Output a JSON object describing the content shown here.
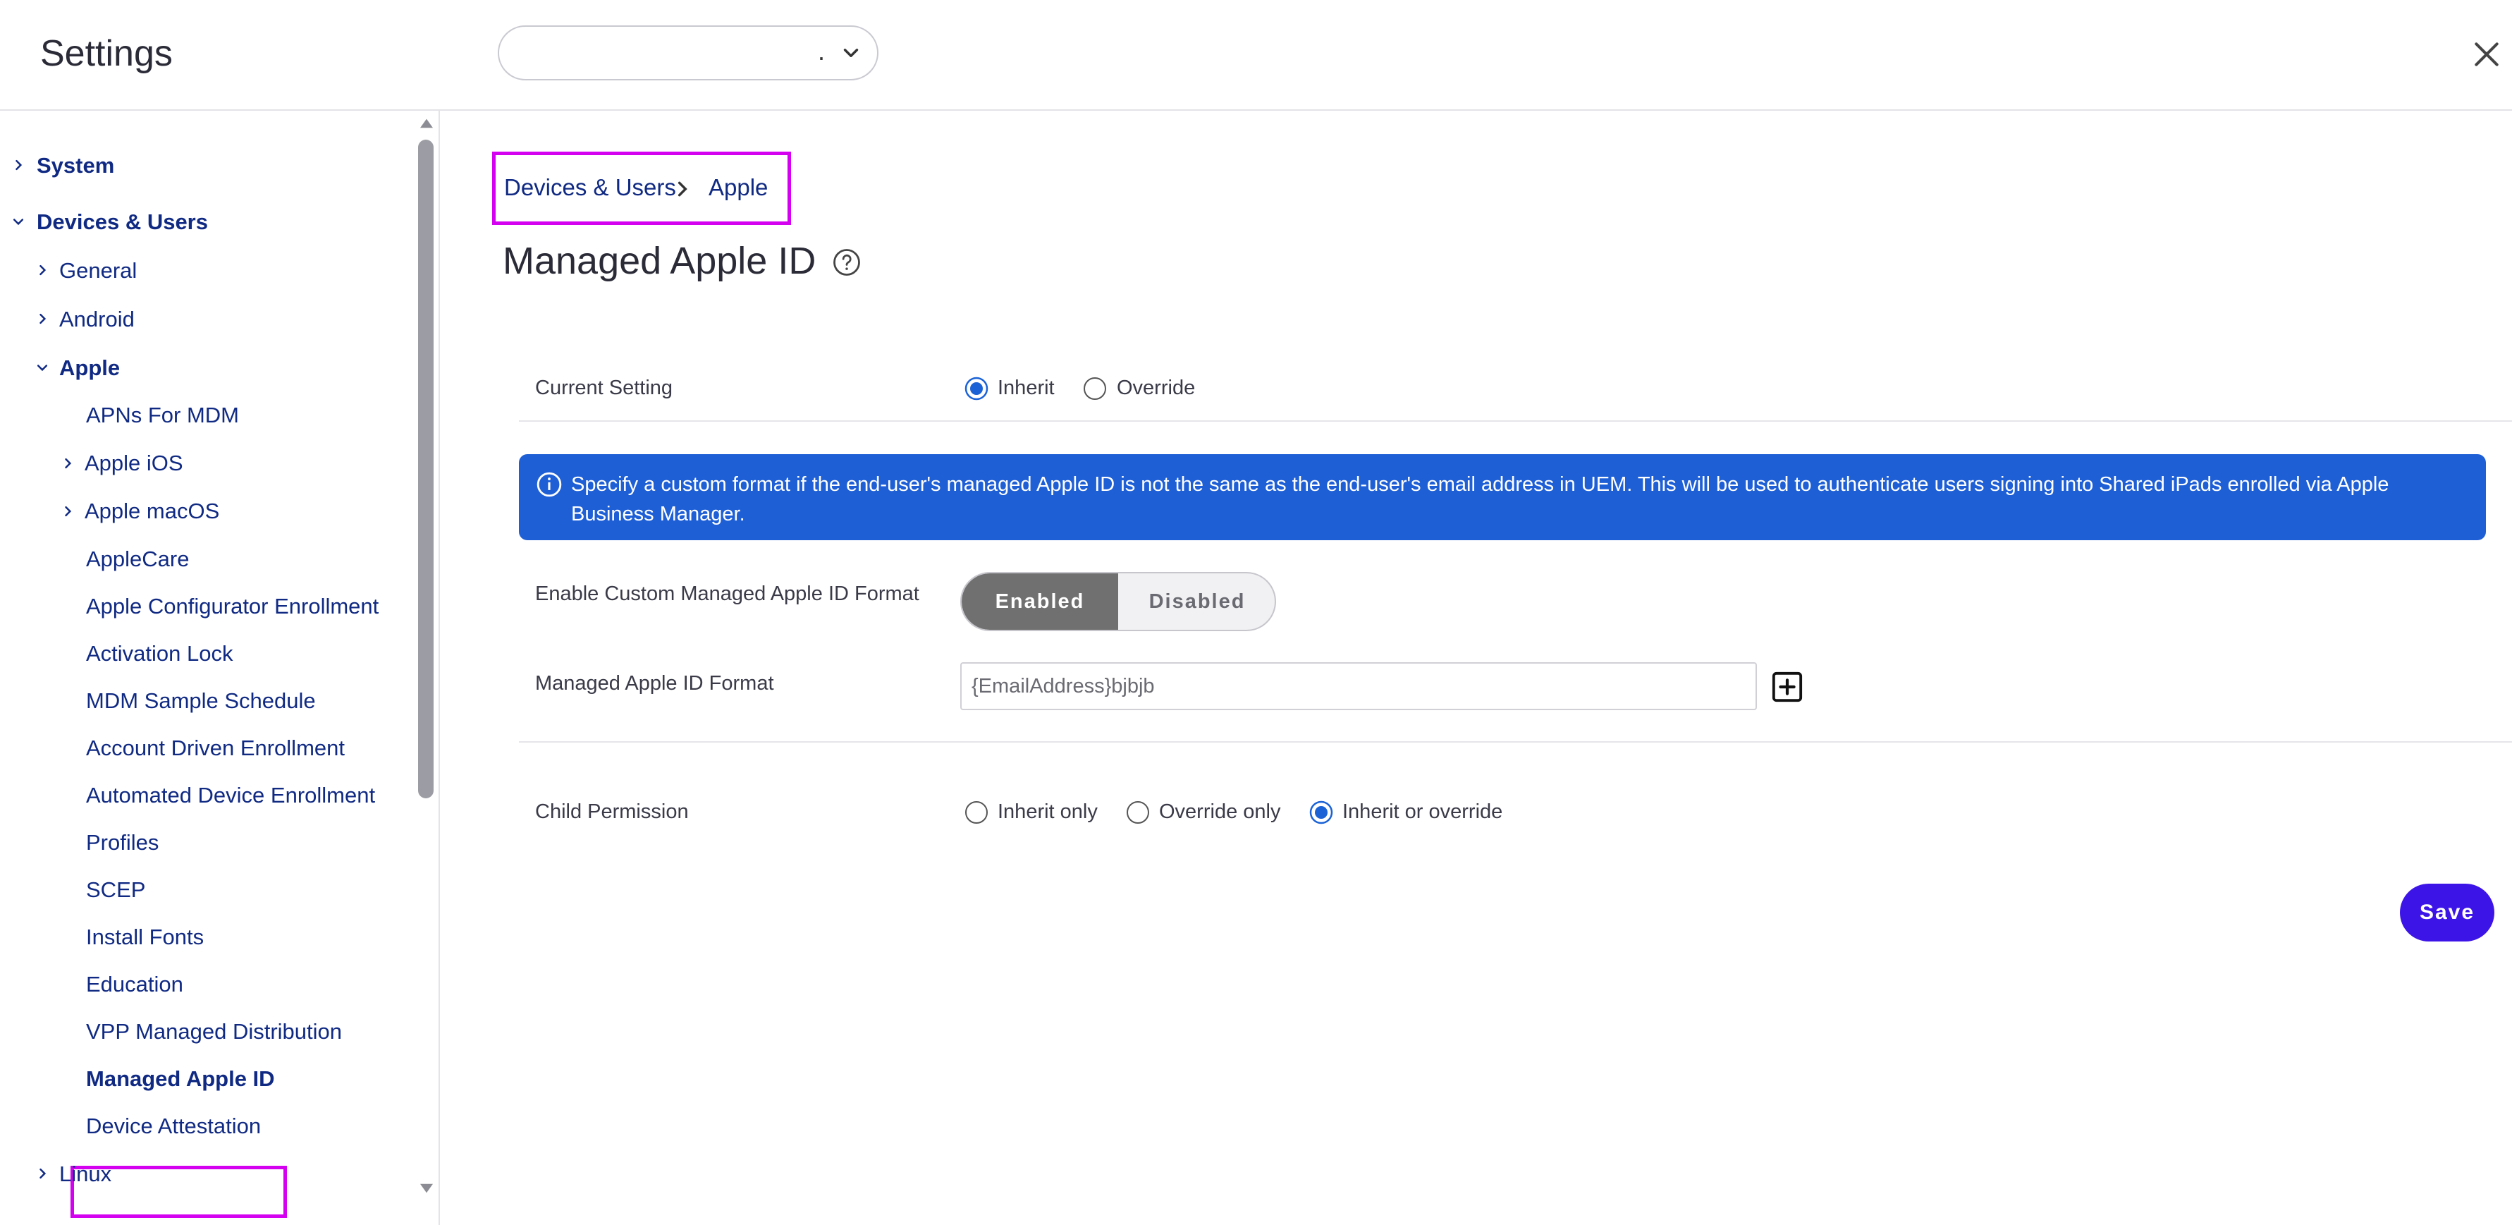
{
  "header": {
    "title": "Settings",
    "org_select_value": "."
  },
  "sidebar": {
    "items": [
      {
        "label": "System"
      },
      {
        "label": "Devices & Users"
      },
      {
        "label": "General"
      },
      {
        "label": "Android"
      },
      {
        "label": "Apple"
      },
      {
        "label": "APNs For MDM"
      },
      {
        "label": "Apple iOS"
      },
      {
        "label": "Apple macOS"
      },
      {
        "label": "AppleCare"
      },
      {
        "label": "Apple Configurator Enrollment"
      },
      {
        "label": "Activation Lock"
      },
      {
        "label": "MDM Sample Schedule"
      },
      {
        "label": "Account Driven Enrollment"
      },
      {
        "label": "Automated Device Enrollment"
      },
      {
        "label": "Profiles"
      },
      {
        "label": "SCEP"
      },
      {
        "label": "Install Fonts"
      },
      {
        "label": "Education"
      },
      {
        "label": "VPP Managed Distribution"
      },
      {
        "label": "Managed Apple ID"
      },
      {
        "label": "Device Attestation"
      },
      {
        "label": "Linux"
      }
    ],
    "selected": "Managed Apple ID"
  },
  "breadcrumb": {
    "items": [
      "Devices & Users",
      "Apple"
    ]
  },
  "page": {
    "title": "Managed Apple ID"
  },
  "form": {
    "current_setting": {
      "label": "Current Setting",
      "options": [
        "Inherit",
        "Override"
      ],
      "selected": "Inherit"
    },
    "info_text": "Specify a custom format if the end-user's managed Apple ID is not the same as the end-user's email address in UEM. This will be used to authenticate users signing into Shared iPads enrolled via Apple Business Manager.",
    "enable_custom_format": {
      "label": "Enable Custom Managed Apple ID Format",
      "on_label": "Enabled",
      "off_label": "Disabled",
      "value": "Enabled"
    },
    "format": {
      "label": "Managed Apple ID Format",
      "value": "{EmailAddress}bjbjb"
    },
    "child_permission": {
      "label": "Child Permission",
      "options": [
        "Inherit only",
        "Override only",
        "Inherit or override"
      ],
      "selected": "Inherit or override"
    },
    "save_label": "Save"
  },
  "colors": {
    "accent_blue": "#1e5fd6",
    "nav_blue": "#102a83",
    "save_purple": "#3d14e8",
    "highlight_magenta": "#d400f0",
    "toggle_on": "#707070"
  }
}
